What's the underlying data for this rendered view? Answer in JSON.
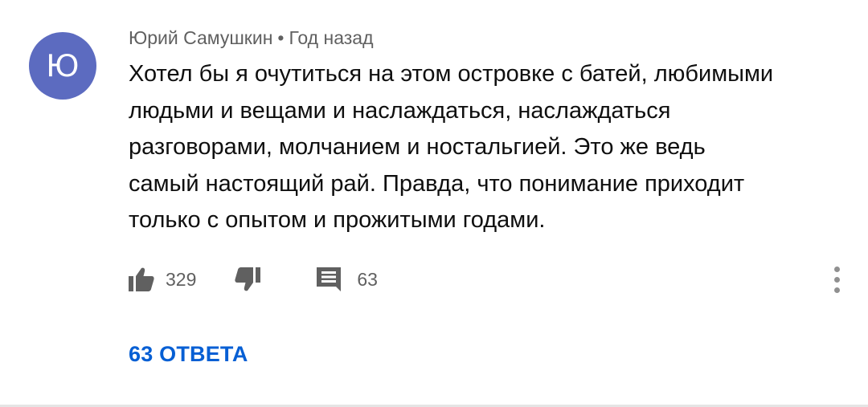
{
  "comment": {
    "avatar_letter": "Ю",
    "avatar_color": "#5c6bc0",
    "author": "Юрий Самушкин",
    "separator": "•",
    "time": "Год назад",
    "text": "Хотел бы я очутиться на этом островке с батей, любимыми\nлюдьми и вещами и наслаждаться, наслаждаться\nразговорами, молчанием и ностальгией. Это же ведь\nсамый настоящий рай. Правда, что понимание приходит\nтолько с опытом и прожитыми годами.",
    "likes": "329",
    "reply_count": "63",
    "replies_link": "63 ОТВЕТА",
    "accent_color": "#065fd4",
    "icons": [
      "thumbs-up-icon",
      "thumbs-down-icon",
      "comment-icon",
      "more-vert-icon"
    ]
  }
}
